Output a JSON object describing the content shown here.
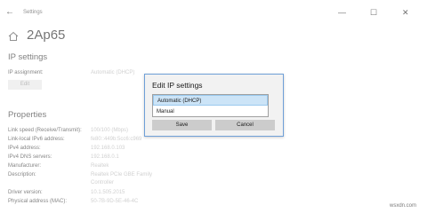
{
  "window": {
    "back_glyph": "←",
    "title": "Settings",
    "minimize_glyph": "—",
    "maximize_glyph": "☐",
    "close_glyph": "✕"
  },
  "page": {
    "title": "2Ap65"
  },
  "ip_settings": {
    "heading": "IP settings",
    "assignment_label": "IP assignment:",
    "assignment_value": "Automatic (DHCP)",
    "edit_label": "Edit"
  },
  "properties": {
    "heading": "Properties",
    "rows": [
      {
        "label": "Link speed (Receive/Transmit):",
        "value": "100/100 (Mbps)"
      },
      {
        "label": "Link-local IPv6 address:",
        "value": "fe80::449b:5cc6:c969"
      },
      {
        "label": "IPv4 address:",
        "value": "192.168.0.103"
      },
      {
        "label": "IPv4 DNS servers:",
        "value": "192.168.0.1"
      },
      {
        "label": "Manufacturer:",
        "value": "Realtek"
      },
      {
        "label": "Description:",
        "value": "Realtek PCIe GBE Family"
      },
      {
        "label": "",
        "value": "Controller"
      },
      {
        "label": "Driver version:",
        "value": "10.1.505.2015"
      },
      {
        "label": "Physical address (MAC):",
        "value": "50-7B-9D-5E-46-4C"
      }
    ]
  },
  "dialog": {
    "title": "Edit IP settings",
    "options": [
      "Automatic (DHCP)",
      "Manual"
    ],
    "selected": "Automatic (DHCP)",
    "save_label": "Save",
    "cancel_label": "Cancel"
  },
  "watermark": "wsxdn.com",
  "colors": {
    "accent": "#6fa0d8",
    "selected_bg": "#cce4f7",
    "button_bg": "#cccccc"
  }
}
